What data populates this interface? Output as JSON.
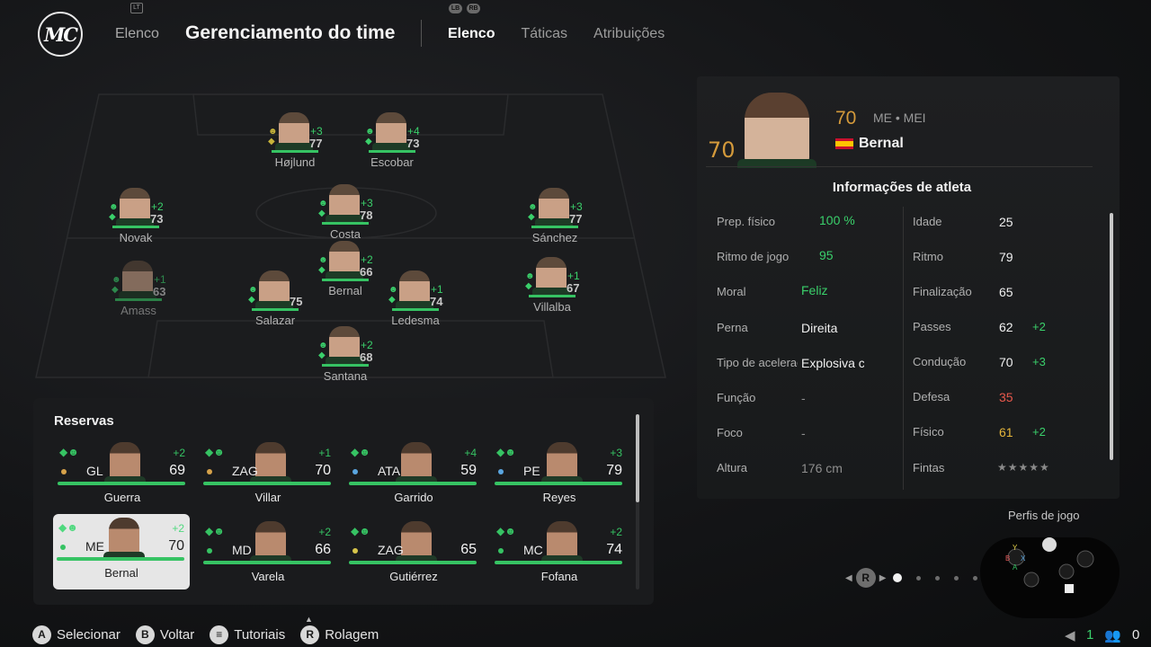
{
  "header": {
    "logo_text": "MC",
    "breadcrumb": "Elenco",
    "title": "Gerenciamento do time",
    "lt_hint": "LT",
    "lb_hint": "LB",
    "rb_hint": "RB",
    "tabs": [
      {
        "label": "Elenco"
      },
      {
        "label": "Táticas"
      },
      {
        "label": "Atribuições"
      }
    ]
  },
  "pitch_players": [
    {
      "name": "Højlund",
      "delta": "+3",
      "ovr": "77"
    },
    {
      "name": "Escobar",
      "delta": "+4",
      "ovr": "73"
    },
    {
      "name": "Novak",
      "delta": "+2",
      "ovr": "73"
    },
    {
      "name": "Costa",
      "delta": "+3",
      "ovr": "78"
    },
    {
      "name": "Sánchez",
      "delta": "+3",
      "ovr": "77"
    },
    {
      "name": "Bernal",
      "delta": "+2",
      "ovr": "66"
    },
    {
      "name": "Amass",
      "delta": "+1",
      "ovr": "63"
    },
    {
      "name": "Salazar",
      "delta": "",
      "ovr": "75"
    },
    {
      "name": "Ledesma",
      "delta": "+1",
      "ovr": "74"
    },
    {
      "name": "Villalba",
      "delta": "+1",
      "ovr": "67"
    },
    {
      "name": "Santana",
      "delta": "+2",
      "ovr": "68"
    }
  ],
  "reserves": {
    "title": "Reservas",
    "players": [
      {
        "pos": "GL",
        "ovr": "69",
        "delta": "+2",
        "name": "Guerra",
        "dot_color": "#d6a24a"
      },
      {
        "pos": "ZAG",
        "ovr": "70",
        "delta": "+1",
        "name": "Villar",
        "dot_color": "#d6a24a"
      },
      {
        "pos": "ATA",
        "ovr": "59",
        "delta": "+4",
        "name": "Garrido",
        "dot_color": "#5aa6e0"
      },
      {
        "pos": "PE",
        "ovr": "79",
        "delta": "+3",
        "name": "Reyes",
        "dot_color": "#5aa6e0"
      },
      {
        "pos": "ME",
        "ovr": "70",
        "delta": "+2",
        "name": "Bernal",
        "dot_color": "#36c363"
      },
      {
        "pos": "MD",
        "ovr": "66",
        "delta": "+2",
        "name": "Varela",
        "dot_color": "#36c363"
      },
      {
        "pos": "ZAG",
        "ovr": "65",
        "delta": "",
        "name": "Gutiérrez",
        "dot_color": "#d6c44a"
      },
      {
        "pos": "MC",
        "ovr": "74",
        "delta": "+2",
        "name": "Fofana",
        "dot_color": "#36c363"
      }
    ]
  },
  "athlete": {
    "ovr_big": "70",
    "ovr": "70",
    "positions": "ME • MEI",
    "name": "Bernal",
    "info_title": "Informações de atleta",
    "left_rows": [
      {
        "label": "Prep. físico",
        "value": "100 %"
      },
      {
        "label": "Ritmo de jogo",
        "value": "95"
      },
      {
        "label": "Moral",
        "value": "Feliz"
      },
      {
        "label": "Perna",
        "value": "Direita"
      },
      {
        "label": "Tipo de aceleração",
        "value": "Explosiva c"
      },
      {
        "label": "Função",
        "value": "-"
      },
      {
        "label": "Foco",
        "value": "-"
      },
      {
        "label": "Altura",
        "value": "176 cm"
      }
    ],
    "right_rows": [
      {
        "label": "Idade",
        "value": "25",
        "delta": ""
      },
      {
        "label": "Ritmo",
        "value": "79",
        "delta": ""
      },
      {
        "label": "Finalização",
        "value": "65",
        "delta": ""
      },
      {
        "label": "Passes",
        "value": "62",
        "delta": "+2"
      },
      {
        "label": "Condução",
        "value": "70",
        "delta": "+3"
      },
      {
        "label": "Defesa",
        "value": "35",
        "delta": ""
      },
      {
        "label": "Físico",
        "value": "61",
        "delta": "+2"
      },
      {
        "label": "Fintas",
        "value": "★★★★★",
        "delta": ""
      }
    ]
  },
  "perfis_label": "Perfis de jogo",
  "pager": {
    "button": "R",
    "pages": 5,
    "current": 1
  },
  "footer": [
    {
      "btn": "A",
      "label": "Selecionar"
    },
    {
      "btn": "B",
      "label": "Voltar"
    },
    {
      "btn": "≡",
      "label": "Tutoriais"
    },
    {
      "btn": "R",
      "label": "Rolagem"
    }
  ],
  "status": {
    "flag_count": "1",
    "people_count": "0"
  }
}
